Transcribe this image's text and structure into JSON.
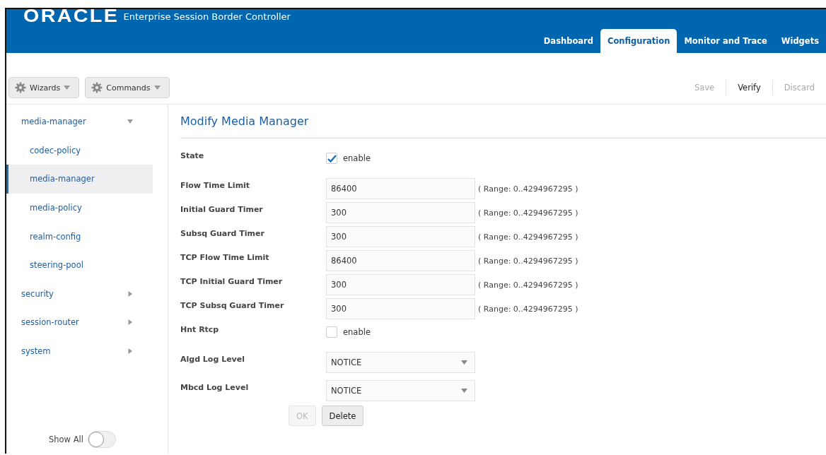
{
  "header": {
    "logo": "ORACLE",
    "product": "Enterprise Session Border Controller",
    "tabs": [
      {
        "label": "Dashboard",
        "selected": false
      },
      {
        "label": "Configuration",
        "selected": true
      },
      {
        "label": "Monitor and Trace",
        "selected": false
      },
      {
        "label": "Widgets",
        "selected": false
      }
    ]
  },
  "toolbar": {
    "menus": [
      {
        "label": "Wizards"
      },
      {
        "label": "Commands"
      }
    ],
    "actions": [
      {
        "label": "Save",
        "disabled": true
      },
      {
        "label": "Verify",
        "disabled": false
      },
      {
        "label": "Discard",
        "disabled": true
      }
    ]
  },
  "sidebar": {
    "items": [
      {
        "label": "media-manager",
        "expanded": true,
        "children": [
          {
            "label": "codec-policy",
            "selected": false
          },
          {
            "label": "media-manager",
            "selected": true
          },
          {
            "label": "media-policy",
            "selected": false
          },
          {
            "label": "realm-config",
            "selected": false
          },
          {
            "label": "steering-pool",
            "selected": false
          }
        ]
      },
      {
        "label": "security",
        "expanded": false
      },
      {
        "label": "session-router",
        "expanded": false
      },
      {
        "label": "system",
        "expanded": false
      }
    ],
    "show_all": {
      "label": "Show All",
      "on": false
    }
  },
  "form": {
    "title": "Modify Media Manager",
    "fields": [
      {
        "kind": "checkbox",
        "label": "State",
        "option": "enable",
        "checked": true
      },
      {
        "kind": "text",
        "label": "Flow Time Limit",
        "value": "86400",
        "hint": "( Range: 0..4294967295 )"
      },
      {
        "kind": "text",
        "label": "Initial Guard Timer",
        "value": "300",
        "hint": "( Range: 0..4294967295 )"
      },
      {
        "kind": "text",
        "label": "Subsq Guard Timer",
        "value": "300",
        "hint": "( Range: 0..4294967295 )"
      },
      {
        "kind": "text",
        "label": "TCP Flow Time Limit",
        "value": "86400",
        "hint": "( Range: 0..4294967295 )"
      },
      {
        "kind": "text",
        "label": "TCP Initial Guard Timer",
        "value": "300",
        "hint": "( Range: 0..4294967295 )"
      },
      {
        "kind": "text",
        "label": "TCP Subsq Guard Timer",
        "value": "300",
        "hint": "( Range: 0..4294967295 )"
      },
      {
        "kind": "checkbox",
        "label": "Hnt Rtcp",
        "option": "enable",
        "checked": false
      },
      {
        "kind": "select",
        "label": "Algd Log Level",
        "value": "NOTICE"
      },
      {
        "kind": "select",
        "label": "Mbcd Log Level",
        "value": "NOTICE"
      }
    ],
    "buttons": [
      {
        "label": "OK",
        "disabled": true
      },
      {
        "label": "Delete",
        "disabled": false
      }
    ]
  }
}
